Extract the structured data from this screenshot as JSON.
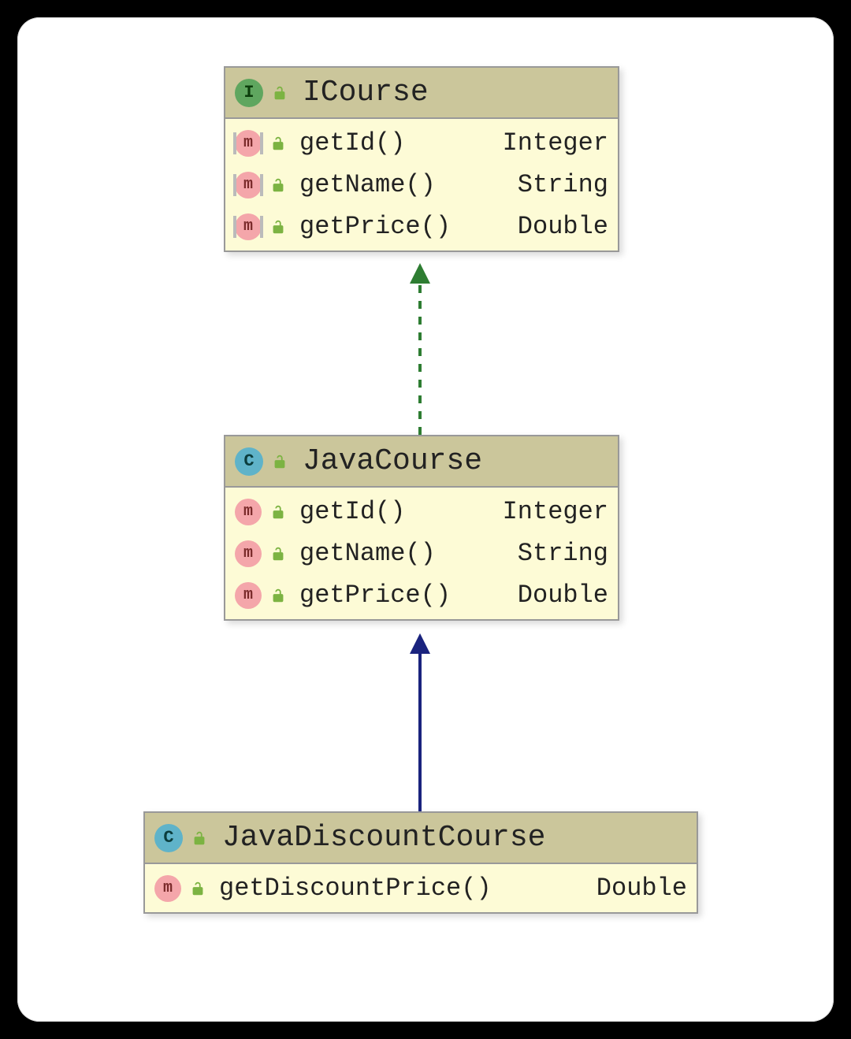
{
  "diagram": {
    "boxes": [
      {
        "id": "icourse",
        "kind": "interface",
        "title": "ICourse",
        "type_letter": "I",
        "methods": [
          {
            "badge": "m",
            "abstract": true,
            "name": "getId()",
            "returns": "Integer"
          },
          {
            "badge": "m",
            "abstract": true,
            "name": "getName()",
            "returns": "String"
          },
          {
            "badge": "m",
            "abstract": true,
            "name": "getPrice()",
            "returns": "Double"
          }
        ]
      },
      {
        "id": "javacourse",
        "kind": "class",
        "title": "JavaCourse",
        "type_letter": "C",
        "methods": [
          {
            "badge": "m",
            "abstract": false,
            "name": "getId()",
            "returns": "Integer"
          },
          {
            "badge": "m",
            "abstract": false,
            "name": "getName()",
            "returns": "String"
          },
          {
            "badge": "m",
            "abstract": false,
            "name": "getPrice()",
            "returns": "Double"
          }
        ]
      },
      {
        "id": "javadiscountcourse",
        "kind": "class",
        "title": "JavaDiscountCourse",
        "type_letter": "C",
        "methods": [
          {
            "badge": "m",
            "abstract": false,
            "name": "getDiscountPrice()",
            "returns": "Double"
          }
        ]
      }
    ],
    "arrows": [
      {
        "from": "javacourse",
        "to": "icourse",
        "style": "dashed",
        "color": "#2e7d32",
        "type": "realization"
      },
      {
        "from": "javadiscountcourse",
        "to": "javacourse",
        "style": "solid",
        "color": "#1a237e",
        "type": "generalization"
      }
    ]
  }
}
